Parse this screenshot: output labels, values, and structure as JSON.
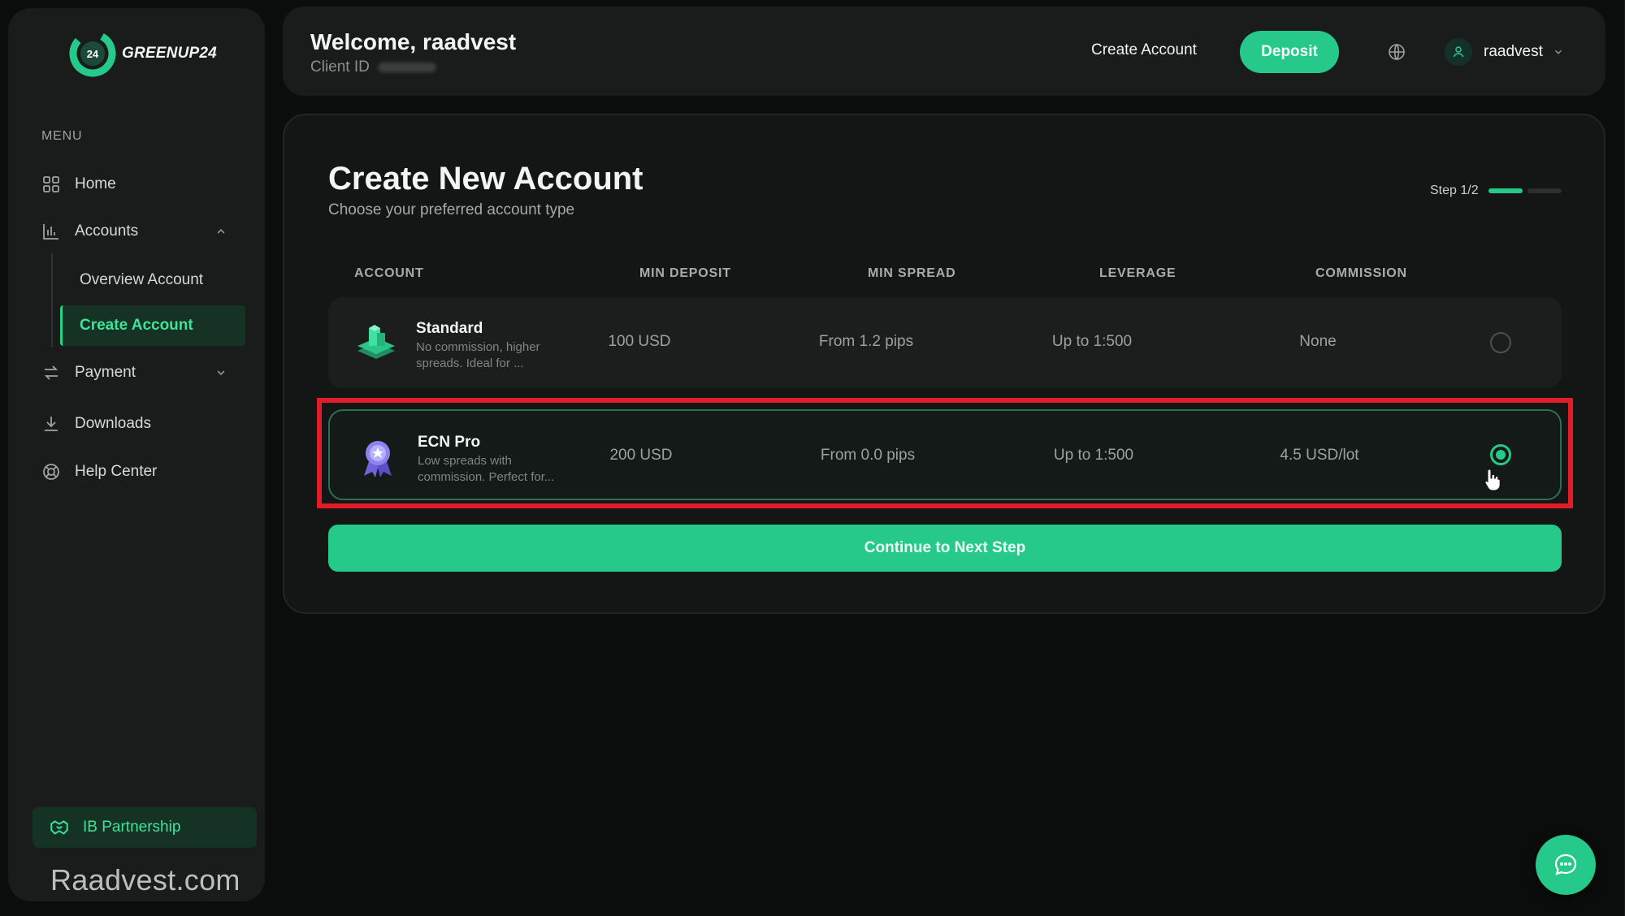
{
  "brand": {
    "name": "GREENUP24",
    "logo_badge": "24",
    "accent": "#25c98a",
    "highlight_color": "#e21d2a"
  },
  "sidebar": {
    "menu_label": "MENU",
    "items": [
      {
        "label": "Home",
        "icon": "grid-icon"
      },
      {
        "label": "Accounts",
        "icon": "bar-chart-icon",
        "expanded": true
      },
      {
        "label": "Payment",
        "icon": "transfer-arrows-icon"
      },
      {
        "label": "Downloads",
        "icon": "download-icon"
      },
      {
        "label": "Help Center",
        "icon": "lifebuoy-icon"
      }
    ],
    "sub_items": [
      {
        "label": "Overview Account"
      },
      {
        "label": "Create Account",
        "active": true
      }
    ],
    "ib_partnership": "IB Partnership"
  },
  "watermark": "Raadvest.com",
  "header": {
    "welcome": "Welcome, raadvest",
    "client_id_label": "Client ID",
    "create_account": "Create Account",
    "deposit": "Deposit",
    "username": "raadvest"
  },
  "page": {
    "title": "Create New Account",
    "subtitle": "Choose your preferred account type",
    "step": "Step 1/2",
    "columns": [
      "ACCOUNT",
      "MIN DEPOSIT",
      "MIN SPREAD",
      "LEVERAGE",
      "COMMISSION"
    ],
    "accounts": [
      {
        "name": "Standard",
        "description": "No commission, higher spreads. Ideal for ...",
        "min_deposit": "100 USD",
        "min_spread": "From 1.2 pips",
        "leverage": "Up to 1:500",
        "commission": "None",
        "selected": false
      },
      {
        "name": "ECN Pro",
        "description": "Low spreads with commission. Perfect for...",
        "min_deposit": "200 USD",
        "min_spread": "From 0.0 pips",
        "leverage": "Up to 1:500",
        "commission": "4.5 USD/lot",
        "selected": true
      }
    ],
    "continue": "Continue to Next Step"
  }
}
